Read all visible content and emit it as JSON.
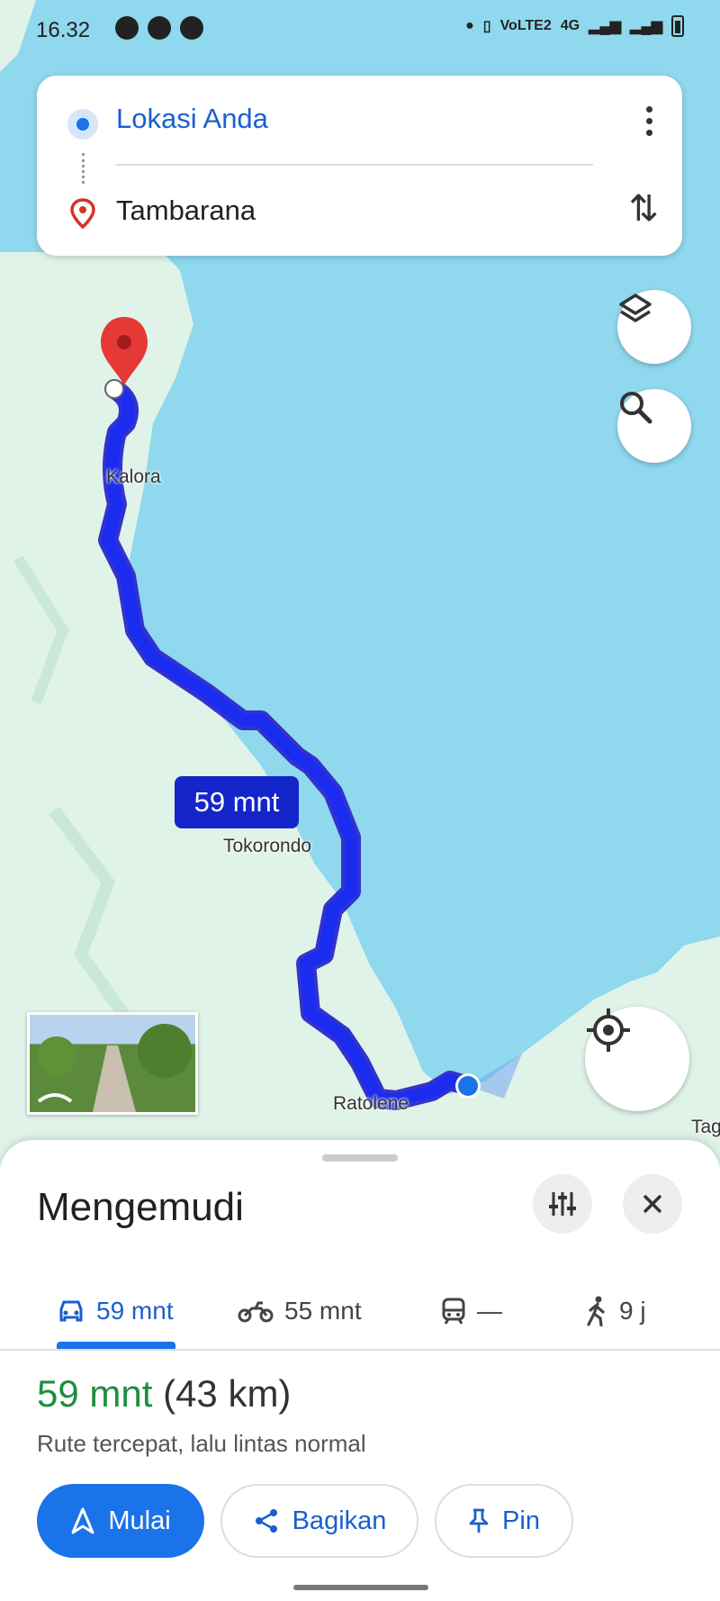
{
  "status_bar": {
    "time": "16.32",
    "network": "4G",
    "volte": "VoLTE2"
  },
  "search": {
    "origin": "Lokasi Anda",
    "destination": "Tambarana"
  },
  "map": {
    "places": {
      "kalora": "Kalora",
      "tokorondo": "Tokorondo",
      "ratolene": "Ratolene",
      "edge": "Tag"
    },
    "eta_bubble": "59 mnt"
  },
  "sheet": {
    "title": "Mengemudi",
    "modes": [
      {
        "icon": "car-icon",
        "label": "59 mnt"
      },
      {
        "icon": "motorcycle-icon",
        "label": "55 mnt"
      },
      {
        "icon": "transit-icon",
        "label": "—"
      },
      {
        "icon": "walk-icon",
        "label": "9 j"
      }
    ],
    "summary": {
      "duration": "59 mnt",
      "distance": "(43 km)"
    },
    "description": "Rute tercepat, lalu lintas normal",
    "buttons": {
      "start": "Mulai",
      "share": "Bagikan",
      "pin": "Pin"
    }
  },
  "colors": {
    "water": "#8fd8ee",
    "land": "#dff3e8",
    "route": "#1426c9",
    "accent": "#1a73e8",
    "duration_green": "#1e8e3e"
  }
}
